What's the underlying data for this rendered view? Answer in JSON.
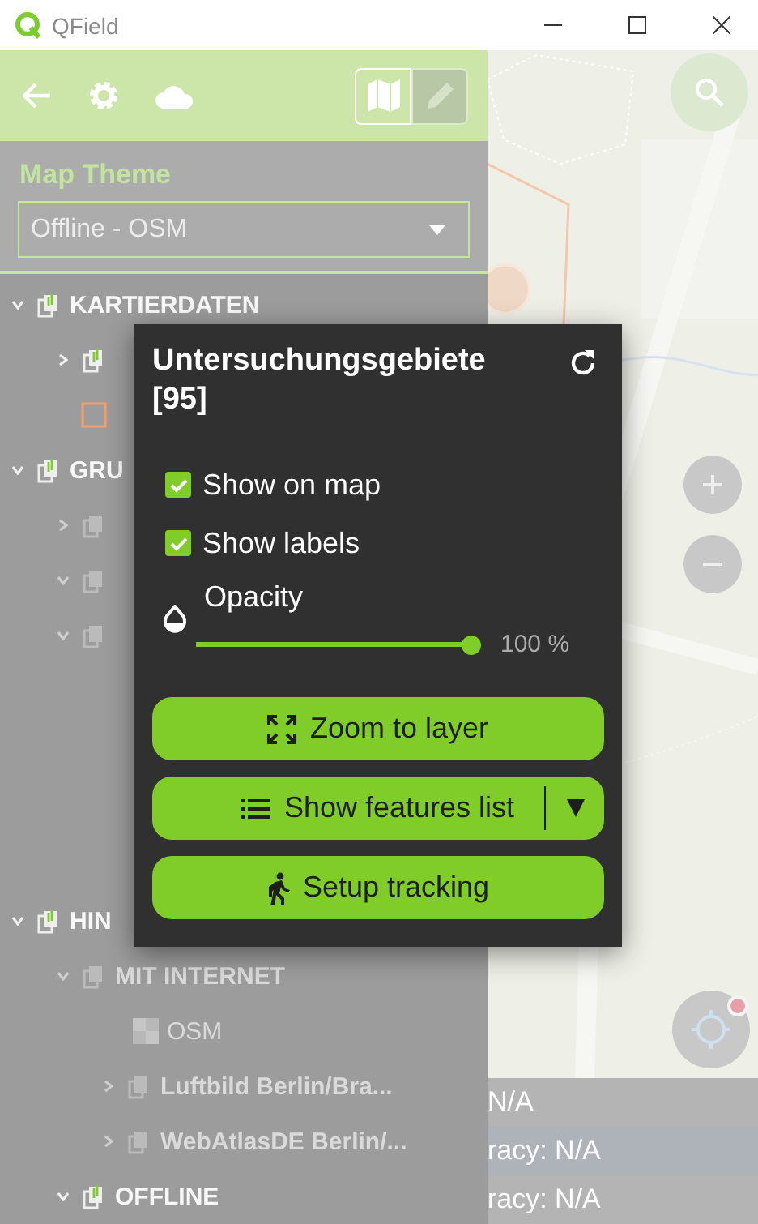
{
  "window": {
    "title": "QField"
  },
  "drawer": {
    "modes": [
      {
        "kind": "map",
        "selected": true
      },
      {
        "kind": "edit",
        "selected": false
      }
    ],
    "map_theme": {
      "label": "Map Theme",
      "value": "Offline - OSM"
    },
    "layer_tree": [
      {
        "kind": "group",
        "label": "KARTIERDATEN",
        "visible": true,
        "expanded": true,
        "children": [
          {
            "kind": "group",
            "visible": true,
            "expanded": false
          },
          {
            "kind": "polygon",
            "visible": false,
            "color": "#f0a070"
          }
        ]
      },
      {
        "kind": "group",
        "label": "GRU",
        "visible": true,
        "expanded": true,
        "children": [
          {
            "kind": "group",
            "visible": false,
            "expanded": false
          },
          {
            "kind": "group",
            "visible": false,
            "expanded": true
          },
          {
            "kind": "group",
            "visible": false,
            "expanded": true
          }
        ]
      },
      {
        "kind": "group",
        "label": "HIN",
        "visible": true,
        "expanded": true,
        "children": [
          {
            "kind": "group",
            "label": "MIT INTERNET",
            "visible": false,
            "expanded": true,
            "children": [
              {
                "kind": "raster",
                "label": "OSM",
                "visible": false
              },
              {
                "kind": "group",
                "label": "Luftbild Berlin/Bra...",
                "visible": false,
                "expanded": false
              },
              {
                "kind": "group",
                "label": "WebAtlasDE Berlin/...",
                "visible": false,
                "expanded": false
              }
            ]
          },
          {
            "kind": "group",
            "label": "OFFLINE",
            "visible": true,
            "expanded": true
          }
        ]
      }
    ]
  },
  "layer_popup": {
    "title": "Untersuchungsgebiete [95]",
    "options": [
      {
        "label": "Show on map",
        "checked": true
      },
      {
        "label": "Show labels",
        "checked": true
      }
    ],
    "opacity": {
      "label": "Opacity",
      "level": 1.0,
      "reading": "100 %"
    },
    "buttons": [
      {
        "kind": "zoom",
        "label": "Zoom to layer",
        "has_menu": false
      },
      {
        "kind": "list",
        "label": "Show features list",
        "has_menu": true
      },
      {
        "kind": "tracking",
        "label": "Setup tracking",
        "has_menu": false
      }
    ]
  },
  "map": {
    "position_info": [
      "N/A",
      "racy: N/A",
      "racy: N/A"
    ]
  }
}
